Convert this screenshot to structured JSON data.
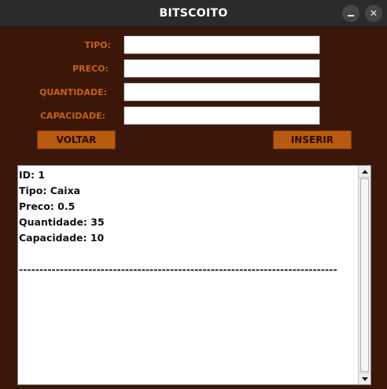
{
  "window": {
    "title": "BITSCOITO"
  },
  "form": {
    "fields": [
      {
        "label": "TIPO:",
        "value": "",
        "placeholder": ""
      },
      {
        "label": "PRECO:",
        "value": "",
        "placeholder": ""
      },
      {
        "label": "QUANTIDADE:",
        "value": "",
        "placeholder": ""
      },
      {
        "label": "CAPACIDADE:",
        "value": "",
        "placeholder": ""
      }
    ],
    "back_label": "VOLTAR",
    "insert_label": "INSERIR"
  },
  "output": {
    "text": "ID: 1\nTipo: Caixa\nPreco: 0.5\nQuantidade: 35\nCapacidade: 10\n\n------------------------------------------------------------------------------"
  },
  "colors": {
    "background": "#3b1609",
    "label": "#c2631a",
    "button": "#b85a0f",
    "titlebar": "#2b2b2b"
  }
}
